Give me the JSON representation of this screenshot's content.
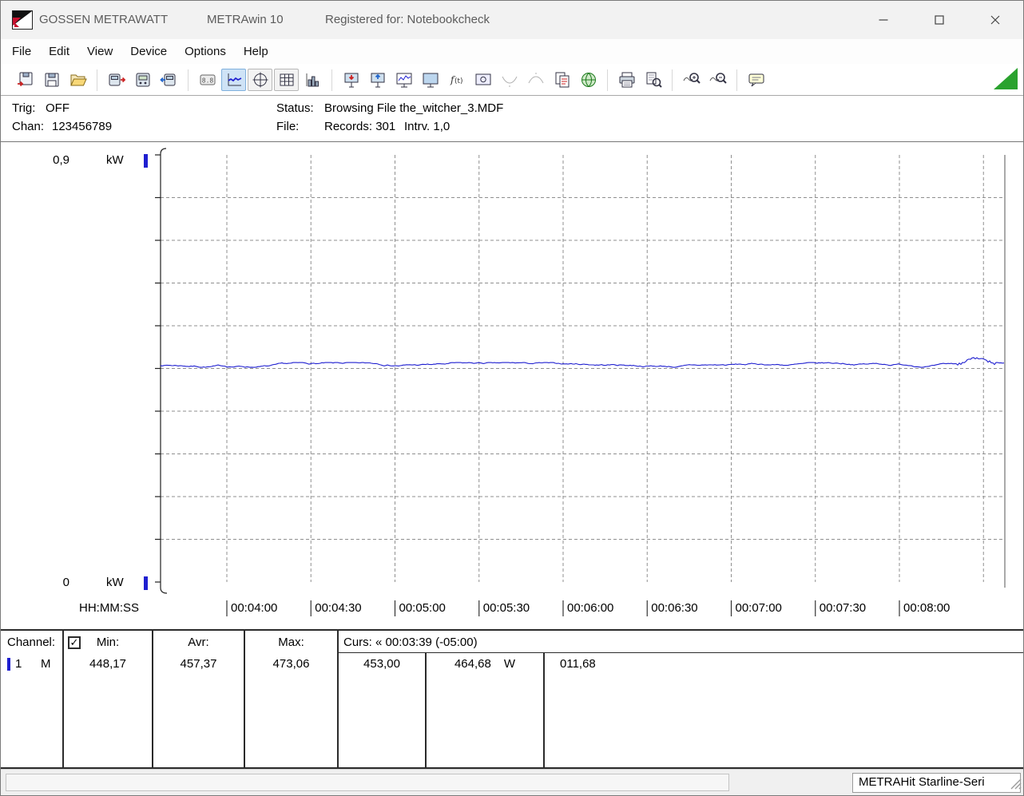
{
  "window": {
    "app_vendor": "GOSSEN METRAWATT",
    "app_name": "METRAwin 10",
    "registered": "Registered for: Notebookcheck",
    "controls": [
      {
        "name": "minimize-button"
      },
      {
        "name": "maximize-button"
      },
      {
        "name": "close-button"
      }
    ]
  },
  "menu": {
    "items": [
      "File",
      "Edit",
      "View",
      "Device",
      "Options",
      "Help"
    ]
  },
  "toolbar": {
    "indicator_color": "#2aa22e",
    "groups": [
      {
        "buttons": [
          {
            "name": "import-file-icon"
          },
          {
            "name": "save-file-icon"
          },
          {
            "name": "open-file-icon"
          }
        ]
      },
      {
        "buttons": [
          {
            "name": "device-read-icon"
          },
          {
            "name": "device-view-icon"
          },
          {
            "name": "device-export-icon"
          }
        ]
      },
      {
        "buttons": [
          {
            "name": "multimeter-view-icon"
          },
          {
            "name": "chart-view-icon",
            "active": true
          },
          {
            "name": "xy-view-icon",
            "framed": true
          },
          {
            "name": "table-view-icon",
            "framed": true
          },
          {
            "name": "histogram-view-icon"
          }
        ]
      },
      {
        "buttons": [
          {
            "name": "device-download-icon"
          },
          {
            "name": "device-upload-icon"
          },
          {
            "name": "live-chart-icon"
          },
          {
            "name": "monitor-icon"
          },
          {
            "name": "formula-icon"
          },
          {
            "name": "snapshot-icon"
          },
          {
            "name": "min-curve-icon",
            "disabled": true
          },
          {
            "name": "max-curve-icon",
            "disabled": true
          },
          {
            "name": "copy-data-icon"
          },
          {
            "name": "online-update-icon"
          }
        ]
      },
      {
        "buttons": [
          {
            "name": "print-icon"
          },
          {
            "name": "print-preview-icon"
          }
        ]
      },
      {
        "buttons": [
          {
            "name": "zoom-in-icon"
          },
          {
            "name": "zoom-out-icon"
          }
        ]
      },
      {
        "buttons": [
          {
            "name": "note-icon"
          }
        ]
      }
    ]
  },
  "info": {
    "trig_label": "Trig:",
    "trig_value": "OFF",
    "chan_label": "Chan:",
    "chan_value": "123456789",
    "status_label": "Status:",
    "status_value": "Browsing File the_witcher_3.MDF",
    "file_label": "File:",
    "file_records": "Records: 301",
    "file_interval": "Intrv. 1,0"
  },
  "chart_data": {
    "type": "line",
    "title": "",
    "y_axis": {
      "top_label": "0,9",
      "bottom_label": "0",
      "unit_label": "kW",
      "min_w": 0,
      "max_w": 900,
      "divisions": 10
    },
    "x_axis": {
      "label": "HH:MM:SS",
      "tick_labels": [
        "00:04:00",
        "00:04:30",
        "00:05:00",
        "00:05:30",
        "00:06:00",
        "00:06:30",
        "00:07:00",
        "00:07:30",
        "00:08:00"
      ],
      "tick_interval_s": 30
    },
    "series": [
      {
        "name": "Channel 1",
        "color": "#1f1fd0",
        "unit": "W",
        "min": 448.17,
        "avg": 457.37,
        "max": 473.06,
        "records": 301,
        "interval_s": 1.0
      }
    ],
    "cursor": {
      "time": "00:03:39",
      "offset": "(-05:00)"
    },
    "grid": "dashed"
  },
  "measurements": {
    "header": {
      "channel": "Channel:",
      "checkbox_checked": true,
      "min": "Min:",
      "avr": "Avr:",
      "max": "Max:",
      "curs": "Curs: « 00:03:39 (-05:00)"
    },
    "rows": [
      {
        "channel": "1",
        "mode": "M",
        "color": "#1f1fd0",
        "min": "448,17",
        "avr": "457,37",
        "max": "473,06",
        "curs_a": "453,00",
        "curs_b": "464,68",
        "curs_b_unit": "W",
        "curs_delta": "011,68"
      }
    ]
  },
  "statusbar": {
    "device": "METRAHit Starline-Seri"
  }
}
